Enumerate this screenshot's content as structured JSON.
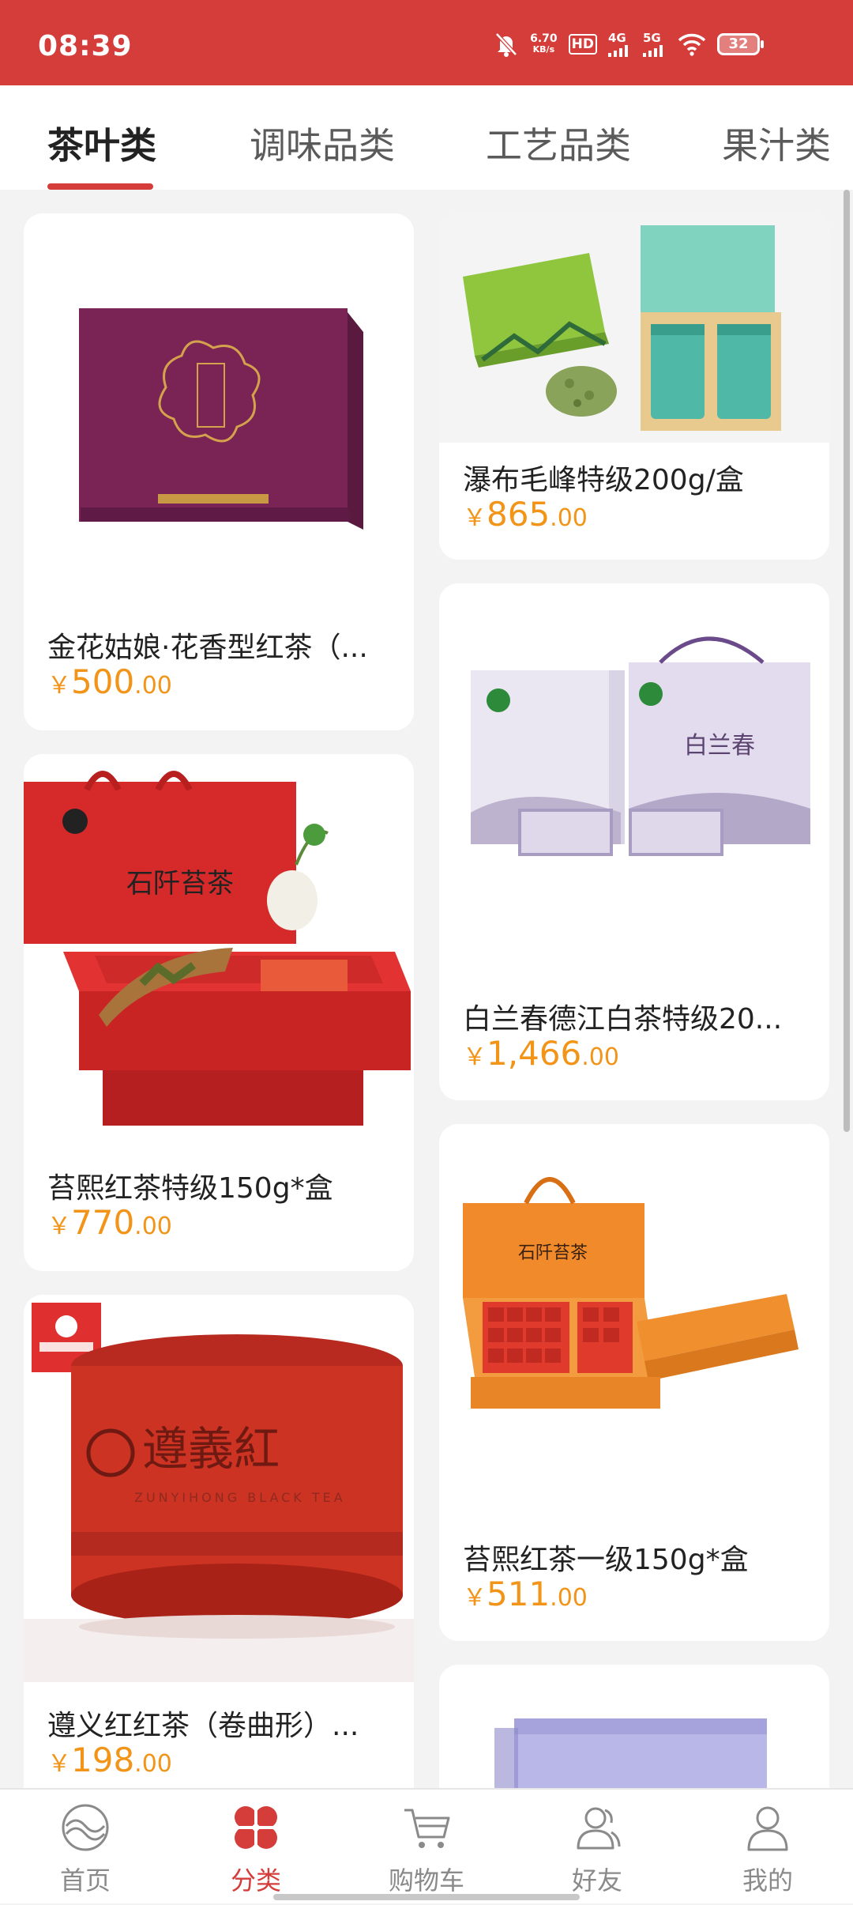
{
  "status_bar": {
    "time": "08:39",
    "net_speed": "6.70",
    "net_unit": "KB/s",
    "hd": "HD",
    "net_4g": "4G",
    "net_5g": "5G",
    "battery": "32"
  },
  "tabs": [
    {
      "label": "茶叶类",
      "active": true
    },
    {
      "label": "调味品类",
      "active": false
    },
    {
      "label": "工艺品类",
      "active": false
    },
    {
      "label": "果汁类",
      "active": false
    }
  ],
  "products": [
    {
      "title": "金花姑娘·花香型红茶（...",
      "currency": "￥",
      "price_int": "500",
      "price_dec": ".00",
      "image": "purple-gift-box"
    },
    {
      "title": "瀑布毛峰特级200g/盒",
      "currency": "￥",
      "price_int": "865",
      "price_dec": ".00",
      "image": "green-tea-box-set"
    },
    {
      "title": "苔熙红茶特级150g*盒",
      "currency": "￥",
      "price_int": "770",
      "price_dec": ".00",
      "image": "red-tea-gift-box"
    },
    {
      "title": "白兰春德江白茶特级20...",
      "currency": "￥",
      "price_int": "1,466",
      "price_dec": ".00",
      "image": "white-tea-bags"
    },
    {
      "title": "遵义红红茶（卷曲形）...",
      "currency": "￥",
      "price_int": "198",
      "price_dec": ".00",
      "image": "red-tea-tin"
    },
    {
      "title": "苔熙红茶一级150g*盒",
      "currency": "￥",
      "price_int": "511",
      "price_dec": ".00",
      "image": "orange-tea-box"
    },
    {
      "title": "",
      "image": "lavender-gift-bag"
    }
  ],
  "image_text": {
    "box_label": "石阡苔茶",
    "brand_cn": "遵義紅",
    "brand_en": "ZUNYIHONG BLACK TEA",
    "baichun": "白兰春"
  },
  "bottom_nav": [
    {
      "label": "首页",
      "icon": "home-wave-icon",
      "active": false
    },
    {
      "label": "分类",
      "icon": "category-petals-icon",
      "active": true
    },
    {
      "label": "购物车",
      "icon": "cart-icon",
      "active": false
    },
    {
      "label": "好友",
      "icon": "friends-icon",
      "active": false
    },
    {
      "label": "我的",
      "icon": "profile-icon",
      "active": false
    }
  ],
  "colors": {
    "brand_red": "#d43d3a",
    "price_orange": "#f29417"
  }
}
